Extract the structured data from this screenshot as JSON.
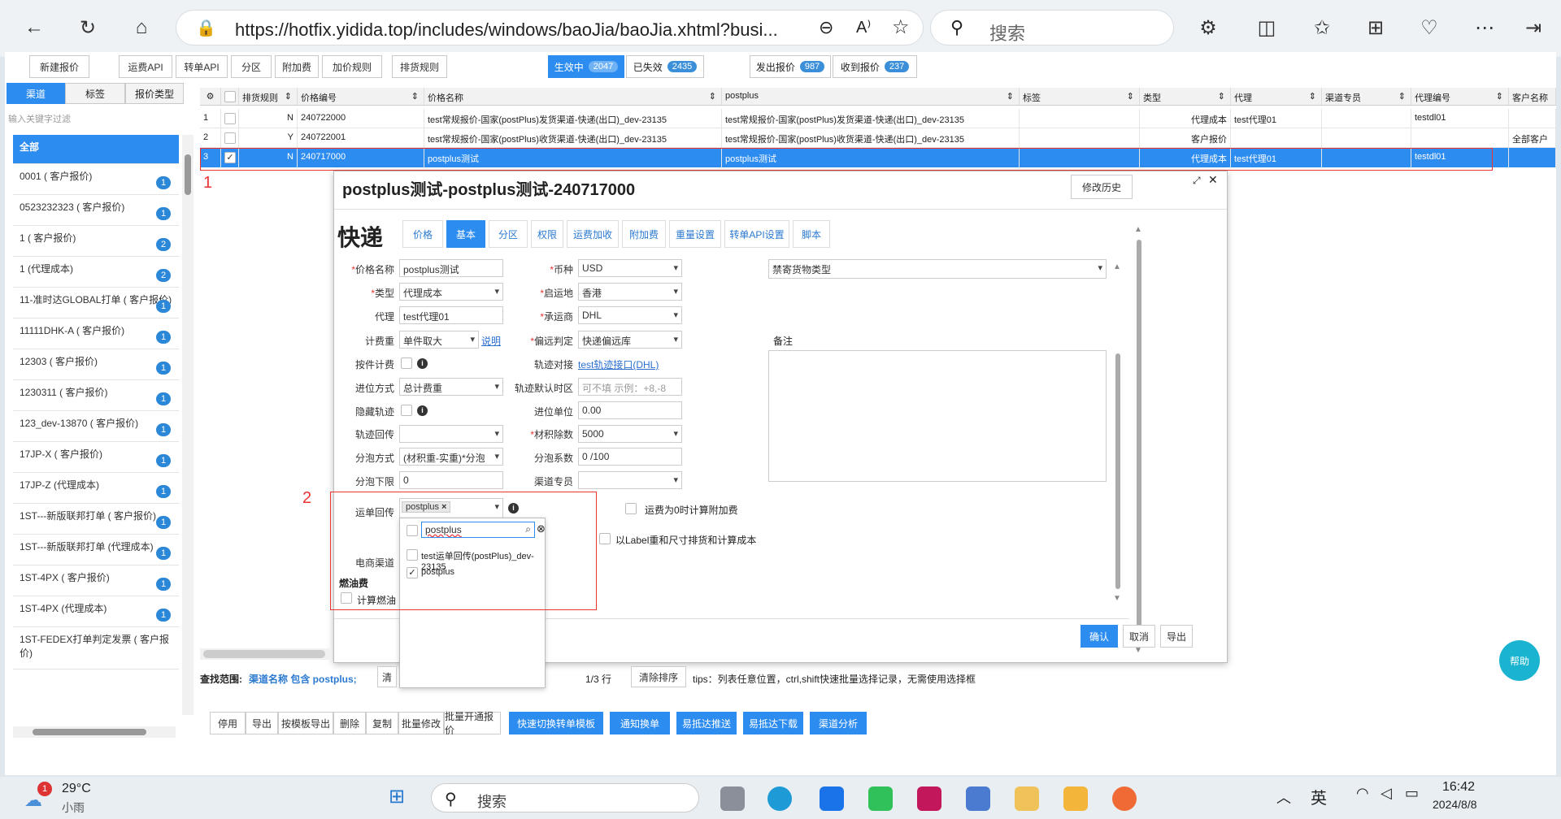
{
  "browser": {
    "url": "https://hotfix.yidida.top/includes/windows/baoJia/baoJia.xhtml?busi...",
    "search_placeholder": "搜索",
    "read_aloud": "A⁾"
  },
  "toolbar": {
    "new_quote": "新建报价",
    "shipping_api": "运费API",
    "transfer_api": "转单API",
    "partition": "分区",
    "surcharge": "附加费",
    "markup_rules": "加价规则",
    "sort_rules": "排货规则"
  },
  "status_filters": {
    "active_label": "生效中",
    "active_count": "2047",
    "expired_label": "已失效",
    "expired_count": "2435"
  },
  "quote_filters": {
    "sent_label": "发出报价",
    "sent_count": "987",
    "received_label": "收到报价",
    "received_count": "237"
  },
  "left_tabs": [
    "渠道",
    "标签",
    "报价类型"
  ],
  "left_filter_placeholder": "输入关键字过滤",
  "left_items": [
    {
      "label": "全部",
      "count": ""
    },
    {
      "label": "0001 ( 客户报价)",
      "count": "1"
    },
    {
      "label": "0523232323 ( 客户报价)",
      "count": "1"
    },
    {
      "label": "1 ( 客户报价)",
      "count": "2"
    },
    {
      "label": "1 (代理成本)",
      "count": "2"
    },
    {
      "label": "11-准时达GLOBAL打单 ( 客户报价)",
      "count": "1"
    },
    {
      "label": "11111DHK-A ( 客户报价)",
      "count": "1"
    },
    {
      "label": "12303 ( 客户报价)",
      "count": "1"
    },
    {
      "label": "1230311 ( 客户报价)",
      "count": "1"
    },
    {
      "label": "123_dev-13870 ( 客户报价)",
      "count": "1"
    },
    {
      "label": "17JP-X ( 客户报价)",
      "count": "1"
    },
    {
      "label": "17JP-Z (代理成本)",
      "count": "1"
    },
    {
      "label": "1ST---新版联邦打单 ( 客户报价)",
      "count": "1"
    },
    {
      "label": "1ST---新版联邦打单 (代理成本)",
      "count": "1"
    },
    {
      "label": "1ST-4PX ( 客户报价)",
      "count": "1"
    },
    {
      "label": "1ST-4PX (代理成本)",
      "count": "1"
    },
    {
      "label": "1ST-FEDEX打单判定发票 ( 客户报价)",
      "count": ""
    }
  ],
  "grid": {
    "headers": [
      "排货规则",
      "价格编号",
      "价格名称",
      "postplus",
      "标签",
      "类型",
      "代理",
      "渠道专员",
      "代理编号",
      "客户名称"
    ],
    "rows": [
      {
        "n": "1",
        "rule": "N",
        "code": "240722000",
        "name": "test常规报价-国家(postPlus)发货渠道-快递(出口)_dev-23135",
        "pp": "test常规报价-国家(postPlus)发货渠道-快递(出口)_dev-23135",
        "type": "代理成本",
        "agent": "test代理01",
        "agent_code": "testdl01",
        "customer": ""
      },
      {
        "n": "2",
        "rule": "Y",
        "code": "240722001",
        "name": "test常规报价-国家(postPlus)收货渠道-快递(出口)_dev-23135",
        "pp": "test常规报价-国家(postPlus)收货渠道-快递(出口)_dev-23135",
        "type": "客户报价",
        "agent": "",
        "agent_code": "",
        "customer": "全部客户"
      },
      {
        "n": "3",
        "rule": "N",
        "code": "240717000",
        "name": "postplus测试",
        "pp": "postplus测试",
        "type": "代理成本",
        "agent": "test代理01",
        "agent_code": "testdl01",
        "customer": ""
      }
    ]
  },
  "annotations": {
    "one": "1",
    "two": "2"
  },
  "modal": {
    "title": "postplus测试-postplus测试-240717000",
    "history": "修改历史",
    "express": "快递",
    "tabs": [
      "价格",
      "基本",
      "分区",
      "权限",
      "运费加收",
      "附加费",
      "重量设置",
      "转单API设置",
      "脚本"
    ],
    "fields": {
      "price_name_label": "价格名称",
      "price_name": "postplus测试",
      "type_label": "类型",
      "type": "代理成本",
      "agent_label": "代理",
      "agent": "test代理01",
      "billing_weight_label": "计费重",
      "billing_weight": "单件取大",
      "explain": "说明",
      "per_piece_label": "按件计费",
      "rounding_label": "进位方式",
      "rounding": "总计费重",
      "hide_track_label": "隐藏轨迹",
      "track_return_label": "轨迹回传",
      "split_method_label": "分泡方式",
      "split_method": "(材积重-实重)*分泡",
      "split_lower_label": "分泡下限",
      "split_lower": "0",
      "waybill_return_label": "运单回传",
      "waybill_tag": "postplus",
      "ecommerce_label": "电商渠道",
      "fuel_label": "燃油费",
      "fuel_calc": "计算燃油",
      "currency_label": "币种",
      "currency": "USD",
      "origin_label": "启运地",
      "origin": "香港",
      "carrier_label": "承运商",
      "carrier": "DHL",
      "remote_label": "偏远判定",
      "remote": "快递偏远库",
      "track_link_label": "轨迹对接",
      "track_link": "test轨迹接口(DHL)",
      "track_tz_label": "轨迹默认时区",
      "track_tz_placeholder": "可不填 示例：+8,-8",
      "unit_label": "进位单位",
      "unit": "0.00",
      "divisor_label": "材积除数",
      "divisor": "5000",
      "split_coef_label": "分泡系数",
      "split_coef": "0 /100",
      "specialist_label": "渠道专员",
      "zero_surcharge": "运费为0时计算附加费",
      "label_weight": "以Label重和尺寸排货和计算成本",
      "forbidden_goods": "禁寄货物类型",
      "remarks_label": "备注"
    },
    "dropdown": {
      "search_value": "postplus",
      "options": [
        "test运单回传(postPlus)_dev-23135",
        "postplus"
      ]
    },
    "buttons": {
      "confirm": "确认",
      "cancel": "取消",
      "export": "导出"
    }
  },
  "help": "帮助",
  "search_range": {
    "label": "查找范围:",
    "value": "渠道名称 包含 postplus;",
    "clear_prefix": "清",
    "page": "1/3 行",
    "clear_sort": "清除排序",
    "tips": "tips：列表任意位置，ctrl,shift快速批量选择记录，无需使用选择框"
  },
  "bottom_buttons": [
    "停用",
    "导出",
    "按模板导出",
    "删除",
    "复制",
    "批量修改",
    "批量开通报价",
    "快速切换转单模板",
    "通知换单",
    "易抵达推送",
    "易抵达下载",
    "渠道分析"
  ],
  "taskbar": {
    "temp": "29°C",
    "weather_badge": "1",
    "weather_text": "小雨",
    "search": "搜索",
    "lang": "英",
    "time": "16:42",
    "date": "2024/8/8"
  }
}
